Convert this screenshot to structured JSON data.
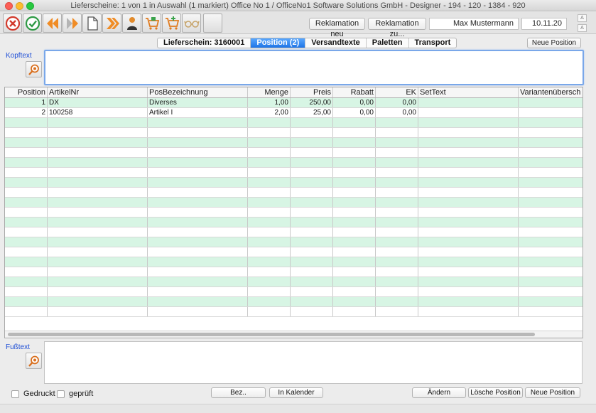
{
  "window": {
    "title": "Lieferscheine: 1 von 1 in Auswahl  (1 markiert) Office No 1 /  OfficeNo1 Software Solutions GmbH - Designer - 194 - 120 - 1384 - 920"
  },
  "toolbar": {
    "buttons": [
      {
        "icon": "cancel-icon"
      },
      {
        "icon": "confirm-icon"
      },
      {
        "icon": "previous-icon"
      },
      {
        "icon": "next-icon"
      },
      {
        "icon": "document-icon"
      },
      {
        "icon": "forward-icon"
      },
      {
        "icon": "person-icon"
      },
      {
        "icon": "cart-icon"
      },
      {
        "icon": "cart-add-icon"
      },
      {
        "icon": "glasses-icon"
      },
      {
        "icon": "empty"
      }
    ]
  },
  "header": {
    "reklamation_neu": "Reklamation neu",
    "reklamation_zu": "Reklamation zu...",
    "user": "Max Mustermann",
    "date": "10.11.20",
    "neue_position": "Neue Position",
    "font_larger": "A",
    "font_smaller": "A"
  },
  "tabs": [
    {
      "label": "Lieferschein: 3160001",
      "active": false
    },
    {
      "label": "Position (2)",
      "active": true
    },
    {
      "label": "Versandtexte",
      "active": false
    },
    {
      "label": "Paletten",
      "active": false
    },
    {
      "label": "Transport",
      "active": false
    }
  ],
  "kopftext": {
    "label": "Kopftext",
    "value": ""
  },
  "table": {
    "columns": [
      "Position",
      "ArtikelNr",
      "PosBezeichnung",
      "Menge",
      "Preis",
      "Rabatt",
      "EK",
      "SetText",
      "Variantenübersch"
    ],
    "rows": [
      [
        "1",
        "DX",
        "Diverses",
        "1,00",
        "250,00",
        "0,00",
        "0,00",
        "",
        ""
      ],
      [
        "2",
        "100258",
        "Artikel I",
        "2,00",
        "25,00",
        "0,00",
        "0,00",
        "",
        ""
      ]
    ]
  },
  "fusstext": {
    "label": "Fußtext",
    "value": ""
  },
  "footer": {
    "gedruckt": "Gedruckt",
    "geprueft": "geprüft",
    "bez": "Bez..",
    "in_kalender": "In Kalender",
    "aendern": "Ändern",
    "loesche_position": "Lösche Position",
    "neue_position": "Neue Position"
  },
  "colors": {
    "accent": "#1e74e6",
    "row_alt": "#d7f5e4",
    "label_blue": "#1f4fd6"
  }
}
